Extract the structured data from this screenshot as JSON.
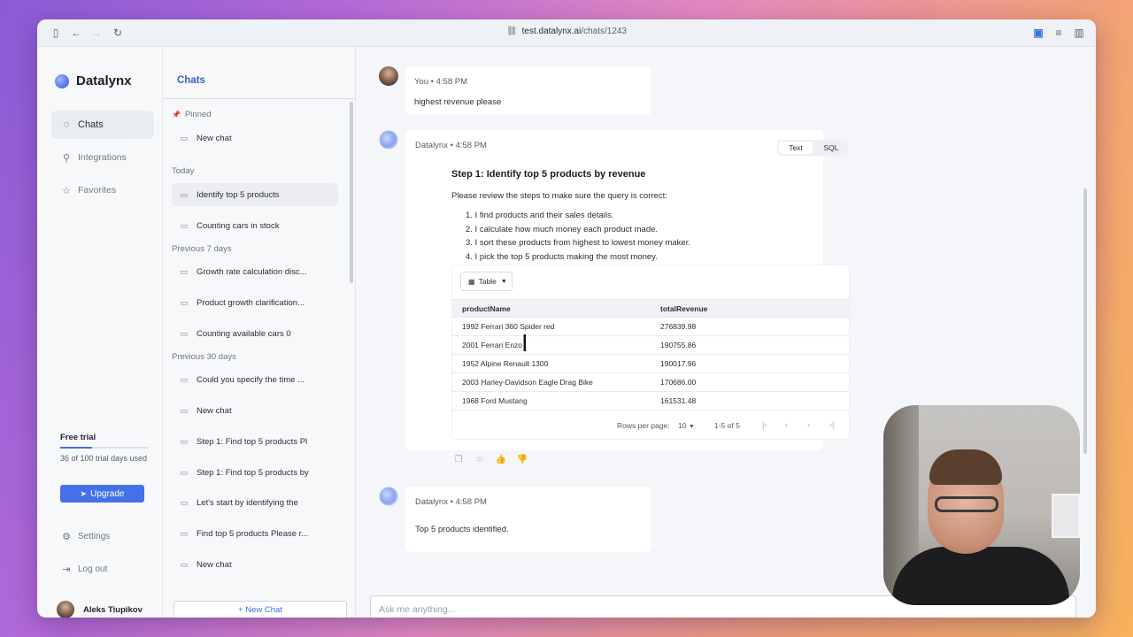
{
  "browser": {
    "url_host": "test.datalynx.ai",
    "url_path": "/chats/1243"
  },
  "sidebar": {
    "brand": "Datalynx",
    "nav": [
      {
        "label": "Chats",
        "icon": "chat-bubble-icon"
      },
      {
        "label": "Integrations",
        "icon": "plug-icon"
      },
      {
        "label": "Favorites",
        "icon": "star-icon"
      }
    ],
    "trial": {
      "title": "Free trial",
      "text": "36 of 100 trial days used",
      "progress": 0.36
    },
    "upgrade_label": "Upgrade",
    "settings_label": "Settings",
    "logout_label": "Log out",
    "user_name": "Aleks Tiupikov"
  },
  "chats": {
    "title": "Chats",
    "pinned_label": "Pinned",
    "pinned": [
      "New chat"
    ],
    "today_label": "Today",
    "today": [
      "Identify top 5 products",
      "Counting cars in stock"
    ],
    "prev7_label": "Previous 7 days",
    "prev7": [
      "Growth rate calculation disc...",
      "Product growth clarification...",
      "Counting available cars 0"
    ],
    "prev30_label": "Previous 30 days",
    "prev30": [
      "Could you specify the time ...",
      "New chat",
      "Step 1: Find top 5 products Pl",
      "Step 1: Find top 5 products by",
      "Let's start by identifying the",
      "Find top 5 products Please r...",
      "New chat"
    ],
    "new_chat_label": "+ New Chat"
  },
  "conversation": {
    "user_msg": {
      "meta": "You • 4:58 PM",
      "text": "highest revenue please"
    },
    "bot_msg": {
      "meta": "Datalynx • 4:58 PM",
      "toggle": [
        "Text",
        "SQL"
      ],
      "title": "Step 1: Identify top 5 products by revenue",
      "review": "Please review the steps to make sure the query is correct:",
      "steps": [
        "1. I find products and their sales details.",
        "2. I calculate how much money each product made.",
        "3. I sort these products from highest to lowest money maker.",
        "4. I pick the top 5 products making the most money."
      ],
      "view_select": "Table",
      "columns": [
        "productName",
        "totalRevenue"
      ],
      "rows": [
        [
          "1992 Ferrari 360 Spider red",
          "276839.98"
        ],
        [
          "2001 Ferrari Enzo",
          "190755.86"
        ],
        [
          "1952 Alpine Renault 1300",
          "190017.96"
        ],
        [
          "2003 Harley-Davidson Eagle Drag Bike",
          "170686.00"
        ],
        [
          "1968 Ford Mustang",
          "161531.48"
        ]
      ],
      "rows_per_page_label": "Rows per page:",
      "rows_per_page": "10",
      "range": "1-5 of 5"
    },
    "bot_msg2": {
      "meta": "Datalynx • 4:58 PM",
      "text": "Top 5 products identified."
    }
  },
  "input": {
    "placeholder": "Ask me anything..."
  }
}
